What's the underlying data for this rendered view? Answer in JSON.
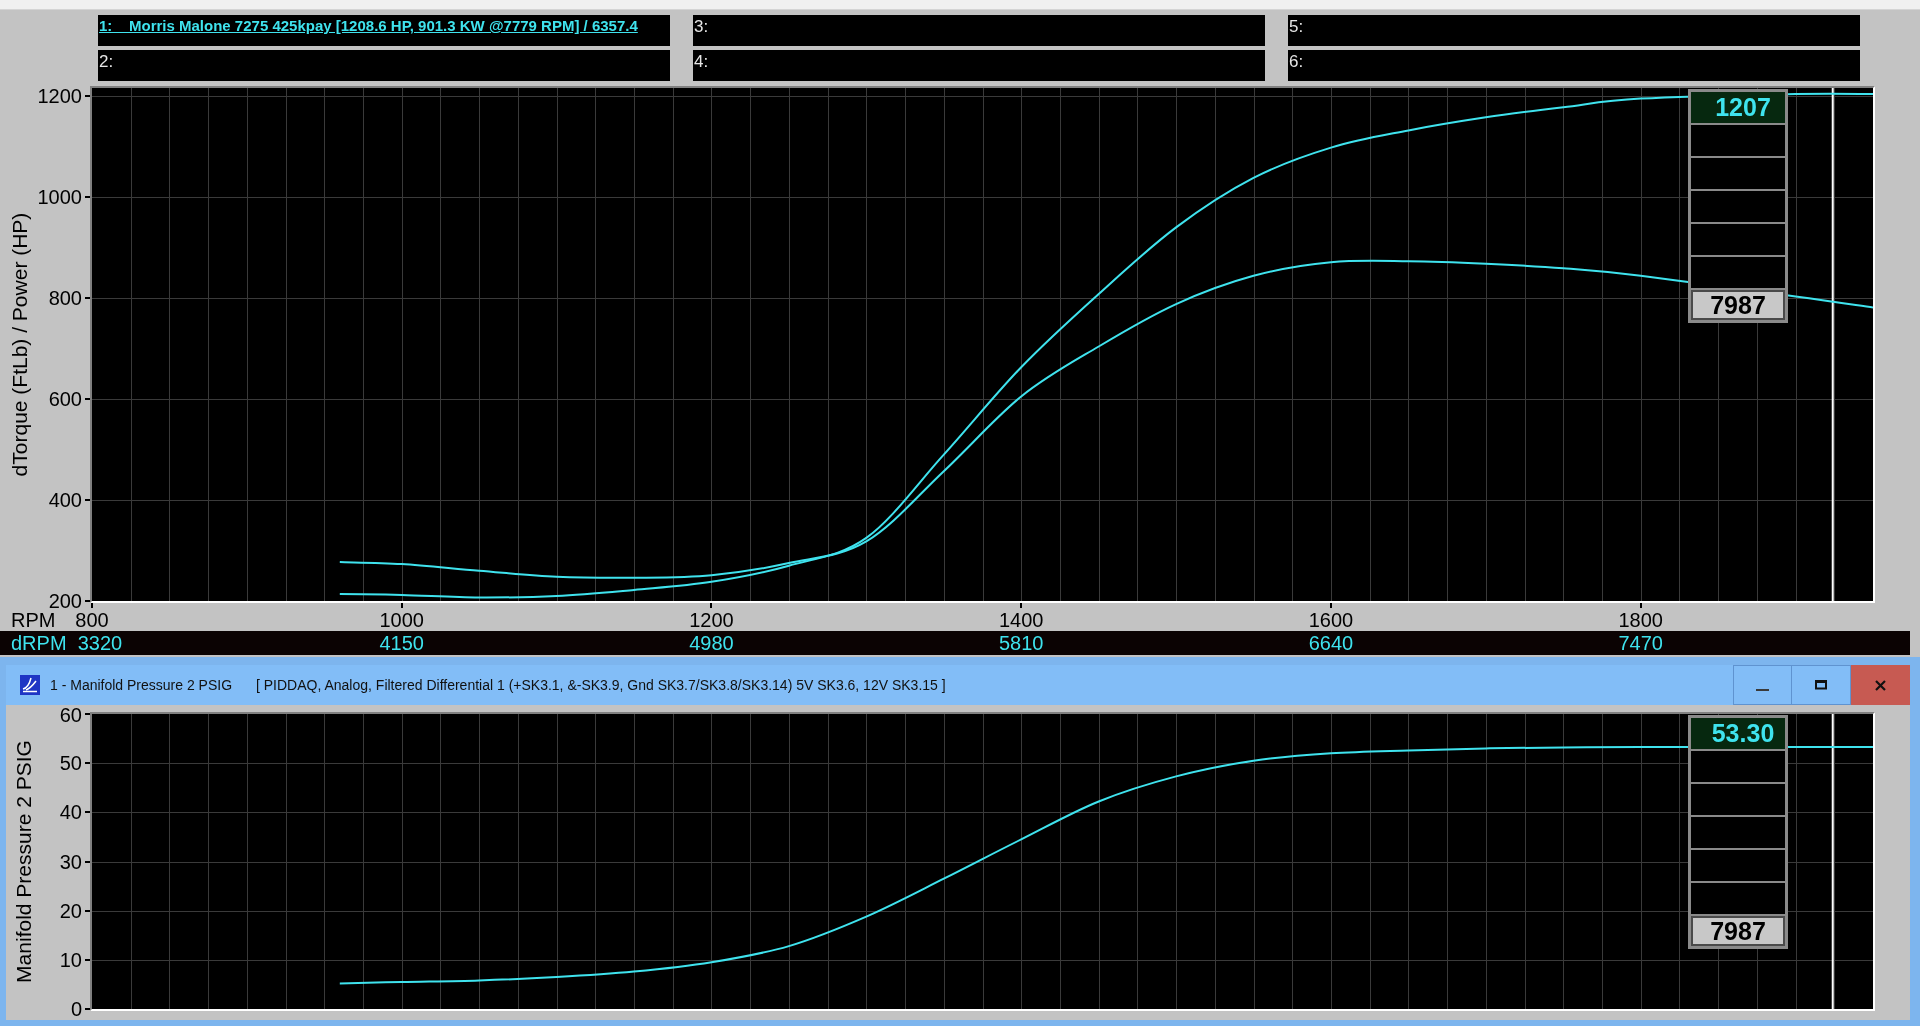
{
  "legend": [
    {
      "label": "1:    Morris Malone 7275 425kpay [1208.6 HP, 901.3 KW @7779 RPM] / 6357.4",
      "loaded": true
    },
    {
      "label": "2:",
      "loaded": false
    },
    {
      "label": "3:",
      "loaded": false
    },
    {
      "label": "4:",
      "loaded": false
    },
    {
      "label": "5:",
      "loaded": false
    },
    {
      "label": "6:",
      "loaded": false
    }
  ],
  "torque_power_panel": {
    "chart_data": {
      "type": "line",
      "xlabel": "RPM",
      "ylabel": "dTorque (FtLb) / Power (HP)",
      "x": [
        960,
        1000,
        1050,
        1100,
        1150,
        1200,
        1250,
        1300,
        1350,
        1400,
        1450,
        1500,
        1550,
        1600,
        1650,
        1700,
        1750,
        1800,
        1900,
        1950
      ],
      "series": [
        {
          "color": "#3fe3ee",
          "values": [
            277,
            273,
            260,
            248,
            246,
            251,
            275,
            318,
            457,
            605,
            704,
            788,
            844,
            871,
            873,
            868,
            859,
            844,
            803,
            781
          ]
        },
        {
          "color": "#3fe3ee",
          "values": [
            214,
            212,
            207,
            210,
            222,
            238,
            270,
            325,
            490,
            663,
            808,
            940,
            1038,
            1098,
            1132,
            1158,
            1178,
            1195,
            1204,
            1204
          ]
        }
      ],
      "xlim": [
        800,
        1950
      ],
      "ylim": [
        200,
        1216
      ],
      "xticks": [
        800,
        1000,
        1200,
        1400,
        1600,
        1800
      ],
      "yticks": [
        200,
        400,
        600,
        800,
        1000,
        1200
      ],
      "grid": true,
      "ref_lines": [
        {
          "axis": "x",
          "value": 1924
        }
      ]
    },
    "readout": {
      "values": [
        "1207"
      ],
      "cursor_rpm": "7987"
    }
  },
  "drpm_scale": {
    "label": "dRPM",
    "ticks": [
      "3320",
      "4150",
      "4980",
      "5810",
      "6640",
      "7470"
    ]
  },
  "pressure_window": {
    "title": "1 - Manifold Pressure 2 PSIG",
    "subtitle": "[ PIDDAQ, Analog, Filtered Differential 1 (+SK3.1, &-SK3.9, Gnd SK3.7/SK3.8/SK3.14) 5V SK3.6, 12V SK3.15 ]",
    "chart_data": {
      "type": "line",
      "ylabel": "Manifold Pressure 2 PSIG",
      "x": [
        960,
        1000,
        1050,
        1100,
        1150,
        1200,
        1250,
        1300,
        1350,
        1400,
        1450,
        1500,
        1550,
        1600,
        1650,
        1700,
        1750,
        1800,
        1900,
        1950
      ],
      "series": [
        {
          "color": "#3fe3ee",
          "values": [
            5.2,
            5.5,
            5.8,
            6.5,
            7.6,
            9.5,
            12.8,
            18.8,
            26.5,
            34.5,
            42.2,
            47.3,
            50.5,
            52.0,
            52.6,
            53.0,
            53.2,
            53.3,
            53.3,
            53.3
          ]
        }
      ],
      "xlim": [
        800,
        1950
      ],
      "ylim": [
        0,
        60
      ],
      "yticks": [
        0,
        10,
        20,
        30,
        40,
        50,
        60
      ],
      "grid": true,
      "ref_lines": [
        {
          "axis": "x",
          "value": 1924
        }
      ]
    },
    "readout": {
      "values": [
        "53.30"
      ],
      "cursor_rpm": "7987"
    }
  }
}
